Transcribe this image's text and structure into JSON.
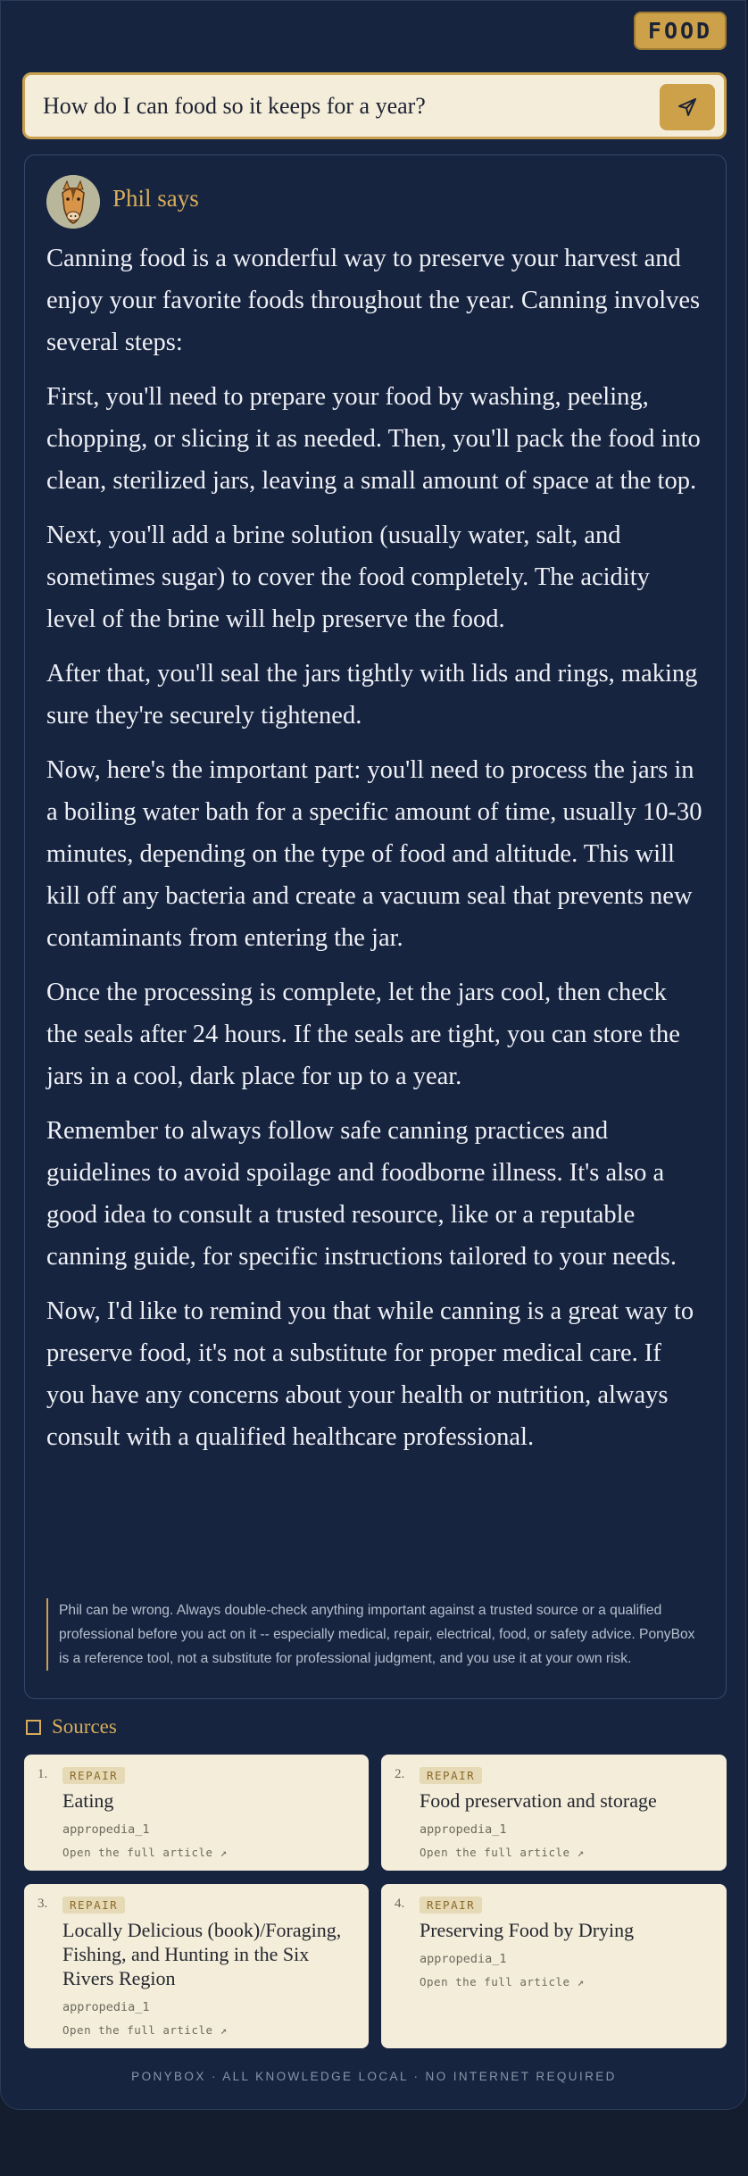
{
  "app": {
    "badge": "FOOD"
  },
  "search": {
    "value": "How do I can food so it keeps for a year?"
  },
  "answer": {
    "speaker": "Phil says",
    "paragraphs": [
      "Canning food is a wonderful way to preserve your harvest and enjoy your favorite foods throughout the year. Canning involves several steps:",
      "First, you'll need to prepare your food by washing, peeling, chopping, or slicing it as needed. Then, you'll pack the food into clean, sterilized jars, leaving a small amount of space at the top.",
      "Next, you'll add a brine solution (usually water, salt, and sometimes sugar) to cover the food completely. The acidity level of the brine will help preserve the food.",
      "After that, you'll seal the jars tightly with lids and rings, making sure they're securely tightened.",
      "Now, here's the important part: you'll need to process the jars in a boiling water bath for a specific amount of time, usually 10-30 minutes, depending on the type of food and altitude. This will kill off any bacteria and create a vacuum seal that prevents new contaminants from entering the jar.",
      "Once the processing is complete, let the jars cool, then check the seals after 24 hours. If the seals are tight, you can store the jars in a cool, dark place for up to a year.",
      "Remember to always follow safe canning practices and guidelines to avoid spoilage and foodborne illness. It's also a good idea to consult a trusted resource, like or a reputable canning guide, for specific instructions tailored to your needs.",
      "Now, I'd like to remind you that while canning is a great way to preserve food, it's not a substitute for proper medical care. If you have any concerns about your health or nutrition, always consult with a qualified healthcare professional."
    ],
    "disclaimer": "Phil can be wrong. Always double-check anything important against a trusted source or a qualified professional before you act on it -- especially medical, repair, electrical, food, or safety advice. PonyBox is a reference tool, not a substitute for professional judgment, and you use it at your own risk."
  },
  "sources": {
    "heading": "Sources",
    "items": [
      {
        "num": "1.",
        "tag": "REPAIR",
        "title": "Eating",
        "meta": "appropedia_1",
        "link": "Open the full article ↗"
      },
      {
        "num": "2.",
        "tag": "REPAIR",
        "title": "Food preservation and storage",
        "meta": "appropedia_1",
        "link": "Open the full article ↗"
      },
      {
        "num": "3.",
        "tag": "REPAIR",
        "title": "Locally Delicious (book)/Foraging, Fishing, and Hunting in the Six Rivers Region",
        "meta": "appropedia_1",
        "link": "Open the full article ↗"
      },
      {
        "num": "4.",
        "tag": "REPAIR",
        "title": "Preserving Food by Drying",
        "meta": "appropedia_1",
        "link": "Open the full article ↗"
      }
    ]
  },
  "footer": {
    "text": "PONYBOX · ALL KNOWLEDGE LOCAL · NO INTERNET REQUIRED"
  },
  "colors": {
    "background": "#172440",
    "accent": "#cda04a",
    "card": "#f3edda"
  }
}
